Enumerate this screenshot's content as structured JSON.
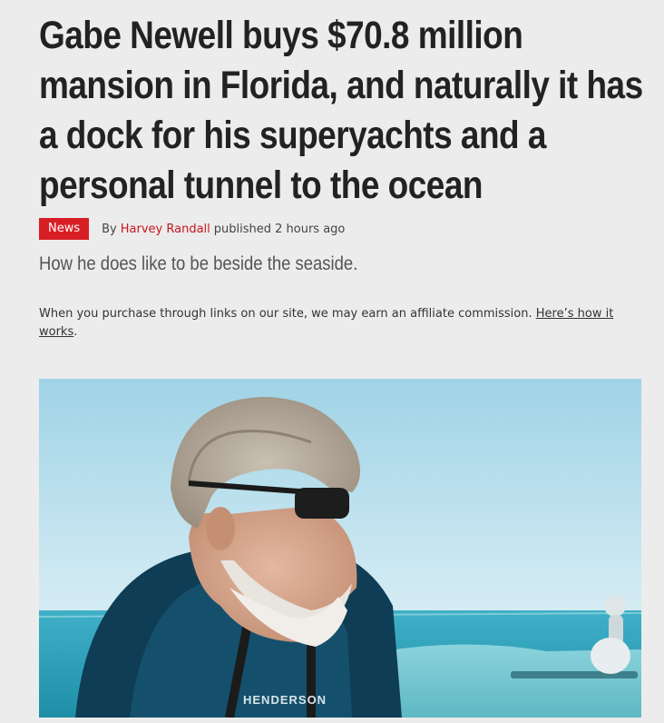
{
  "article": {
    "headline": "Gabe Newell buys $70.8 million mansion in Florida, and naturally it has a dock for his superyachts and a personal tunnel to the ocean",
    "category_badge": "News",
    "byline_prefix": "By",
    "author": "Harvey Randall",
    "published_text": "published 2 hours ago",
    "strapline": "How he does like to be beside the seaside.",
    "affiliate_text": "When you purchase through links on our site, we may earn an affiliate commission.",
    "affiliate_link": "Here’s how it works",
    "affiliate_end": ".",
    "hero_image_text": "HENDERSON"
  },
  "colors": {
    "badge": "#d81e25",
    "author_link": "#c8161d",
    "background": "#ececec"
  }
}
